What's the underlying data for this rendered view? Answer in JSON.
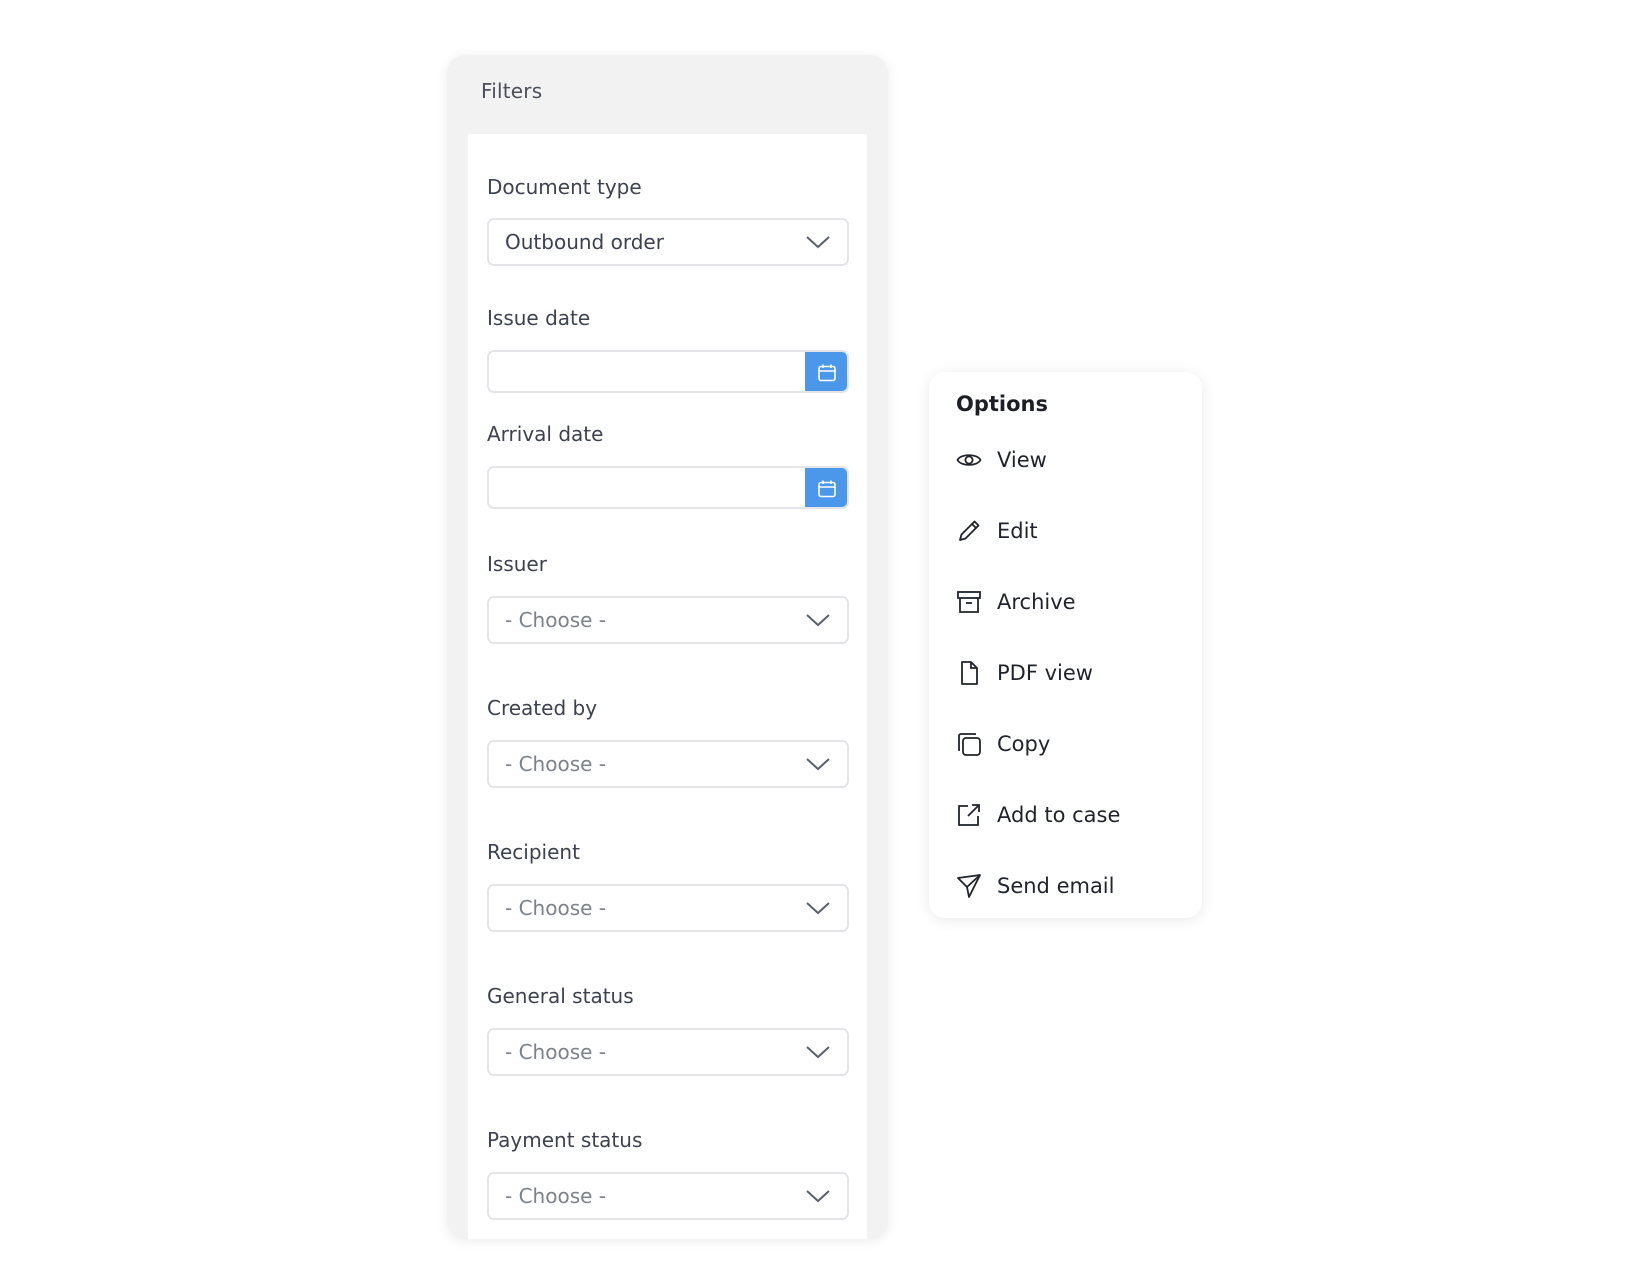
{
  "filters": {
    "title": "Filters",
    "fields": [
      {
        "label": "Document type",
        "kind": "select",
        "value": "Outbound order"
      },
      {
        "label": "Issue date",
        "kind": "date",
        "value": ""
      },
      {
        "label": "Arrival date",
        "kind": "date",
        "value": ""
      },
      {
        "label": "Issuer",
        "kind": "select",
        "value": "- Choose -"
      },
      {
        "label": "Created by",
        "kind": "select",
        "value": "- Choose -"
      },
      {
        "label": "Recipient",
        "kind": "select",
        "value": "- Choose -"
      },
      {
        "label": "General status",
        "kind": "select",
        "value": "- Choose -"
      },
      {
        "label": "Payment status",
        "kind": "select",
        "value": "- Choose -"
      }
    ]
  },
  "options": {
    "title": "Options",
    "items": [
      {
        "label": "View",
        "icon": "eye-icon"
      },
      {
        "label": "Edit",
        "icon": "pencil-icon"
      },
      {
        "label": "Archive",
        "icon": "archive-icon"
      },
      {
        "label": "PDF view",
        "icon": "document-icon"
      },
      {
        "label": "Copy",
        "icon": "copy-icon"
      },
      {
        "label": "Add to case",
        "icon": "external-link-icon"
      },
      {
        "label": "Send email",
        "icon": "send-icon"
      }
    ]
  },
  "colors": {
    "accent": "#4b97ea",
    "panel_bg": "#f2f2f2",
    "border": "#e3e5e8"
  }
}
